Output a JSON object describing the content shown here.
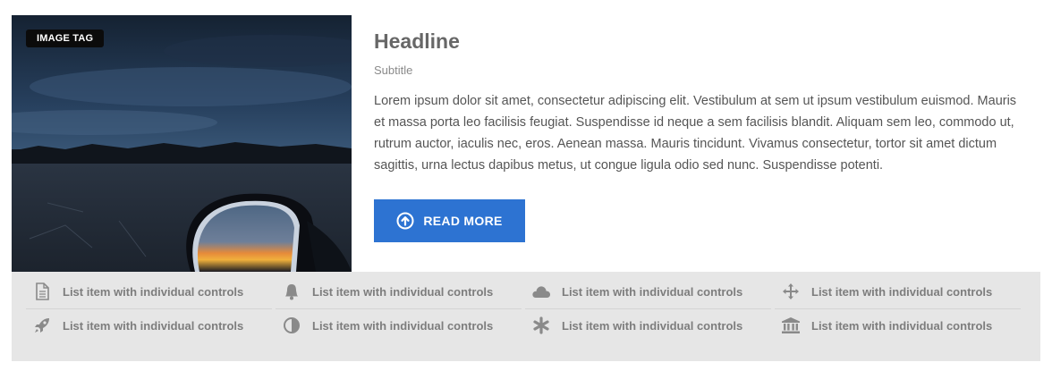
{
  "media": {
    "tag": "IMAGE TAG"
  },
  "content": {
    "headline": "Headline",
    "subtitle": "Subtitle",
    "body": "Lorem ipsum dolor sit amet, consectetur adipiscing elit. Vestibulum at sem ut ipsum vestibulum euismod. Mauris et massa porta leo facilisis feugiat. Suspendisse id neque a sem facilisis blandit. Aliquam sem leo, commodo ut, rutrum auctor, iaculis nec, eros. Aenean massa. Mauris tincidunt. Vivamus consectetur, tortor sit amet dictum sagittis, urna lectus dapibus metus, ut congue ligula odio sed nunc. Suspendisse potenti."
  },
  "button": {
    "label": "READ MORE",
    "icon": "arrow-up-circle-icon",
    "color": "#2d73d2"
  },
  "list": {
    "items": [
      {
        "label": "List item with individual controls",
        "icon": "document-icon"
      },
      {
        "label": "List item with individual controls",
        "icon": "bell-icon"
      },
      {
        "label": "List item with individual controls",
        "icon": "cloud-icon"
      },
      {
        "label": "List item with individual controls",
        "icon": "move-icon"
      },
      {
        "label": "List item with individual controls",
        "icon": "rocket-icon"
      },
      {
        "label": "List item with individual controls",
        "icon": "contrast-icon"
      },
      {
        "label": "List item with individual controls",
        "icon": "asterisk-icon"
      },
      {
        "label": "List item with individual controls",
        "icon": "bank-icon"
      }
    ]
  }
}
